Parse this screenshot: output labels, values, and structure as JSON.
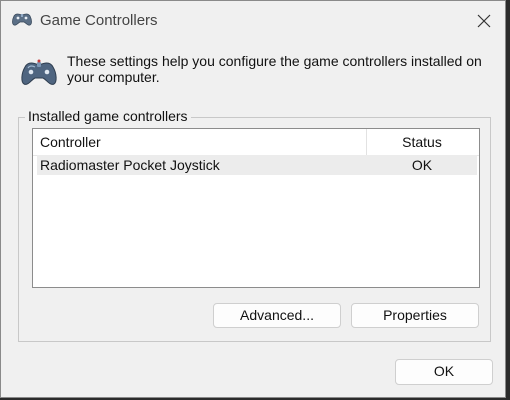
{
  "window": {
    "title": "Game Controllers",
    "title_icon": "gamepad-icon",
    "close_icon": "close-icon"
  },
  "intro": {
    "icon": "gamepad-icon",
    "text": "These settings help you configure the game controllers installed on your computer."
  },
  "group": {
    "label": "Installed game controllers"
  },
  "list": {
    "headers": {
      "controller": "Controller",
      "status": "Status"
    },
    "rows": [
      {
        "controller": "Radiomaster Pocket Joystick",
        "status": "OK"
      }
    ]
  },
  "buttons": {
    "advanced": "Advanced...",
    "properties": "Properties",
    "ok": "OK"
  }
}
